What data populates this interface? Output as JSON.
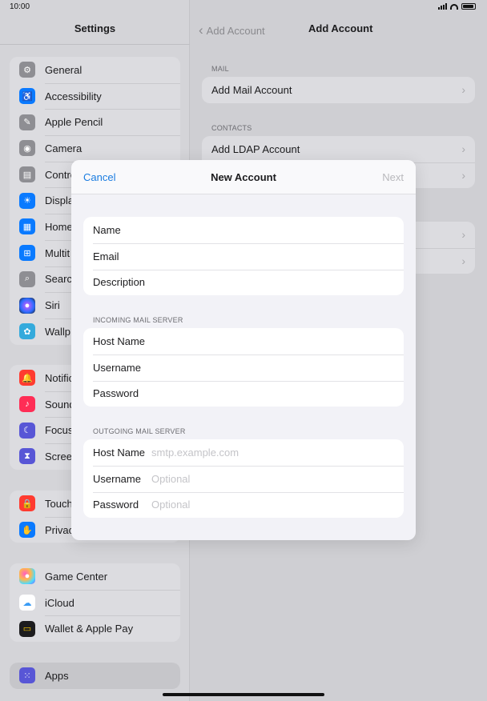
{
  "status": {
    "time": "10:00"
  },
  "sidebar": {
    "title": "Settings",
    "groups": [
      [
        {
          "label": "General",
          "icon": "gear-icon",
          "color": "#8e8e93"
        },
        {
          "label": "Accessibility",
          "icon": "accessibility-icon",
          "color": "#0a7aff"
        },
        {
          "label": "Apple Pencil",
          "icon": "pencil-icon",
          "color": "#8e8e93"
        },
        {
          "label": "Camera",
          "icon": "camera-icon",
          "color": "#8e8e93"
        },
        {
          "label": "Contro",
          "icon": "control-centre-icon",
          "color": "#8e8e93"
        },
        {
          "label": "Displa",
          "icon": "brightness-icon",
          "color": "#0a7aff"
        },
        {
          "label": "Home",
          "icon": "home-screen-icon",
          "color": "#0a7aff"
        },
        {
          "label": "Multit",
          "icon": "multitasking-icon",
          "color": "#0a7aff"
        },
        {
          "label": "Searc",
          "icon": "search-icon",
          "color": "#8e8e93"
        },
        {
          "label": "Siri",
          "icon": "siri-icon",
          "color": "#1c1c1e"
        },
        {
          "label": "Wallp",
          "icon": "wallpaper-icon",
          "color": "#34aadc"
        }
      ],
      [
        {
          "label": "Notific",
          "icon": "notifications-icon",
          "color": "#ff3b30"
        },
        {
          "label": "Sound",
          "icon": "sound-icon",
          "color": "#ff2d55"
        },
        {
          "label": "Focus",
          "icon": "moon-icon",
          "color": "#5856d6"
        },
        {
          "label": "Scree",
          "icon": "hourglass-icon",
          "color": "#5856d6"
        }
      ],
      [
        {
          "label": "Touch",
          "icon": "lock-icon",
          "color": "#ff3b30"
        },
        {
          "label": "Privac",
          "icon": "hand-icon",
          "color": "#0a7aff"
        }
      ],
      [
        {
          "label": "Game Center",
          "icon": "game-center-icon",
          "color": "#ffffff"
        },
        {
          "label": "iCloud",
          "icon": "cloud-icon",
          "color": "#ffffff"
        },
        {
          "label": "Wallet & Apple Pay",
          "icon": "wallet-icon",
          "color": "#1c1c1e"
        }
      ],
      [
        {
          "label": "Apps",
          "icon": "apps-grid-icon",
          "color": "#5856d6"
        }
      ]
    ]
  },
  "detail": {
    "back_label": "Add Account",
    "title": "Add Account",
    "mail_header": "MAIL",
    "mail_items": [
      "Add Mail Account"
    ],
    "contacts_header": "CONTACTS",
    "contacts_items": [
      "Add LDAP Account",
      ""
    ],
    "other_items": [
      "",
      ""
    ]
  },
  "modal": {
    "cancel": "Cancel",
    "title": "New Account",
    "next": "Next",
    "account_fields": [
      "Name",
      "Email",
      "Description"
    ],
    "incoming_header": "INCOMING MAIL SERVER",
    "incoming_fields": [
      "Host Name",
      "Username",
      "Password"
    ],
    "outgoing_header": "OUTGOING MAIL SERVER",
    "outgoing_fields": [
      {
        "label": "Host Name",
        "placeholder": "smtp.example.com"
      },
      {
        "label": "Username",
        "placeholder": "Optional"
      },
      {
        "label": "Password",
        "placeholder": "Optional"
      }
    ]
  }
}
